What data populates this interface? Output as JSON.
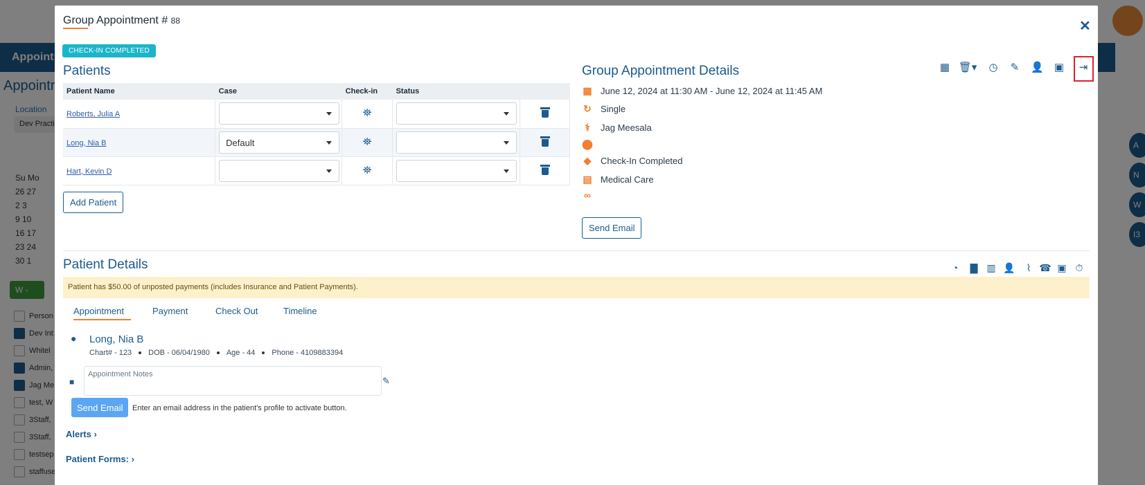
{
  "background": {
    "nav_label": "Appoint",
    "page_title": "Appointr",
    "location_label": "Location",
    "location_value": "Dev Practi",
    "calendar_rows": [
      "Su Mo",
      "26 27",
      "2 3",
      "9 10",
      "16 17",
      "23 24",
      "30 1"
    ],
    "green_button": "W -",
    "list_items": [
      {
        "label": "Person",
        "checked": false
      },
      {
        "label": "Dev Int",
        "checked": true
      },
      {
        "label": "Whitel",
        "checked": false
      },
      {
        "label": "Admin,",
        "checked": true
      },
      {
        "label": "Jag Me",
        "checked": true
      },
      {
        "label": "test, W",
        "checked": false
      },
      {
        "label": "3Staff,",
        "checked": false
      },
      {
        "label": "3Staff,",
        "checked": false
      },
      {
        "label": "testsep",
        "checked": false
      },
      {
        "label": "staffuse",
        "checked": false
      }
    ],
    "right_bubbles": [
      "A",
      "N",
      "W",
      "I3"
    ]
  },
  "modal": {
    "title": "Group Appointment #",
    "appointment_number": "88",
    "status_badge": "CHECK-IN COMPLETED"
  },
  "patients": {
    "heading": "Patients",
    "columns": [
      "Patient Name",
      "Case",
      "Check-in",
      "Status"
    ],
    "rows": [
      {
        "name": "Roberts, Julia A",
        "case": "",
        "status": ""
      },
      {
        "name": "Long, Nia B",
        "case": "Default",
        "status": ""
      },
      {
        "name": "Hart, Kevin D",
        "case": "",
        "status": ""
      }
    ],
    "add_button": "Add Patient"
  },
  "group_details": {
    "heading": "Group Appointment Details",
    "datetime": "June 12, 2024 at 11:30 AM - June 12, 2024 at 11:45 AM",
    "recurrence": "Single",
    "provider": "Jag Meesala",
    "location": "",
    "status": "Check-In Completed",
    "type": "Medical Care",
    "link": "",
    "send_email": "Send Email"
  },
  "patient_details": {
    "heading": "Patient Details",
    "warning": "Patient has $50.00 of unposted payments (includes Insurance and Patient Payments).",
    "tabs": [
      "Appointment",
      "Payment",
      "Check Out",
      "Timeline"
    ],
    "active_tab": "Appointment",
    "name": "Long, Nia B",
    "chart": "Chart# - 123",
    "dob": "DOB - 06/04/1980",
    "age": "Age - 44",
    "phone": "Phone - 4109883394",
    "notes_placeholder": "Appointment Notes",
    "send_email": "Send Email",
    "email_hint": "Enter an email address in the patient's profile to activate button.",
    "alerts": "Alerts",
    "forms": "Patient Forms:"
  },
  "colors": {
    "primary": "#1c5b8d",
    "accent": "#f07f32",
    "badge": "#1ab5c9",
    "warning_bg": "#fdf1cc",
    "highlight": "#e0202a"
  }
}
